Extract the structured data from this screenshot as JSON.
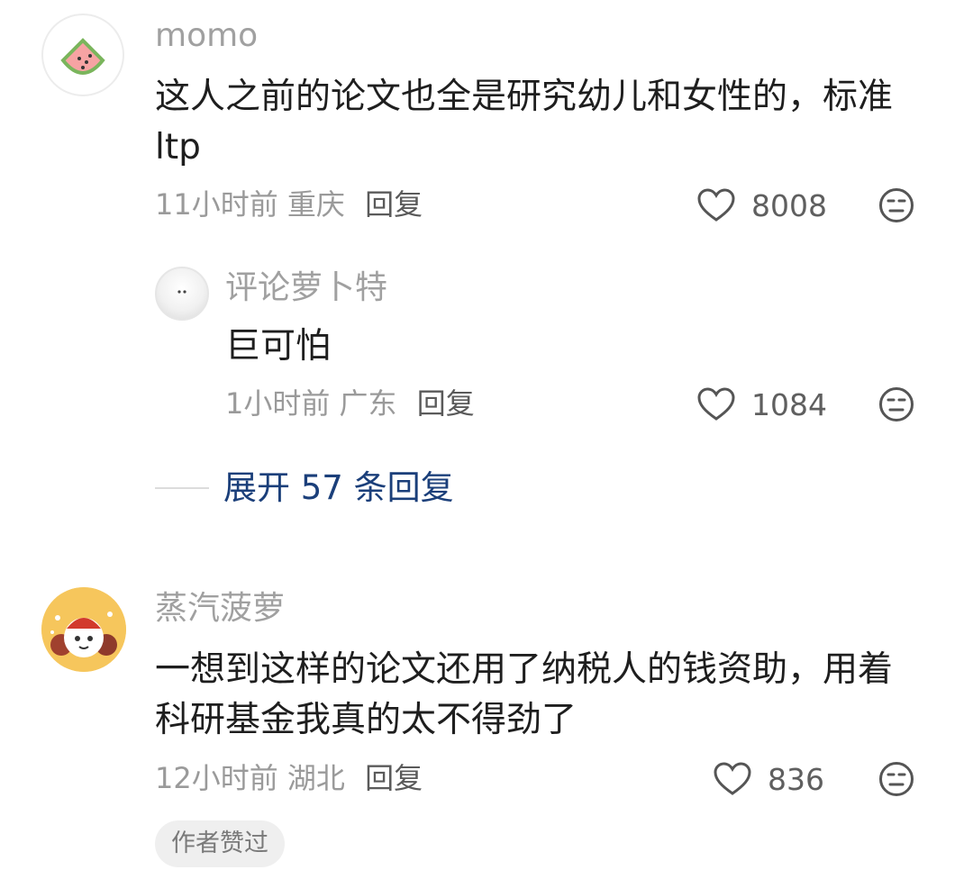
{
  "comments": [
    {
      "name": "momo",
      "text": "这人之前的论文也全是研究幼儿和女性的，标准ltp",
      "time": "11小时前",
      "location": "重庆",
      "reply": "回复",
      "likes": "8008",
      "avatar_icon": "watermelon-icon"
    },
    {
      "name": "蒸汽菠萝",
      "text": "一想到这样的论文还用了纳税人的钱资助，用着科研基金我真的太不得劲了",
      "time": "12小时前",
      "location": "湖北",
      "reply": "回复",
      "likes": "836",
      "badge": "作者赞过",
      "avatar_icon": "cartoon-avatar-icon"
    }
  ],
  "subreply": {
    "name": "评论萝卜特",
    "text": "巨可怕",
    "time": "1小时前",
    "location": "广东",
    "reply": "回复",
    "likes": "1084",
    "avatar_icon": "snowball-avatar-icon"
  },
  "expand_label": "展开 57 条回复",
  "colors": {
    "accent": "#1b3f7a",
    "muted": "#9a9a9a",
    "badge_bg": "#efefef"
  }
}
